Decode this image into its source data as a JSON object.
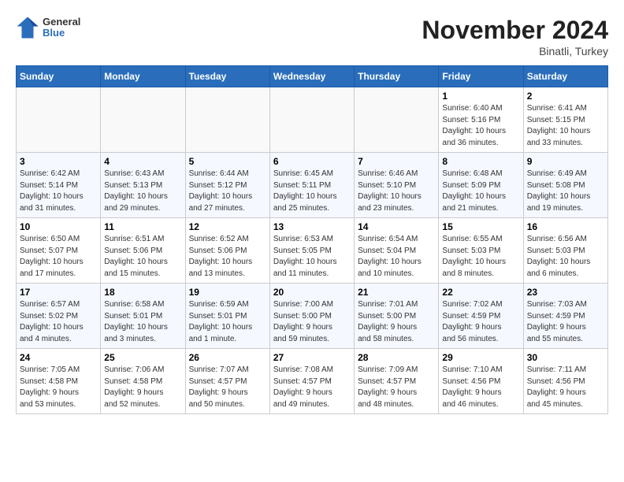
{
  "header": {
    "logo_general": "General",
    "logo_blue": "Blue",
    "month_title": "November 2024",
    "location": "Binatli, Turkey"
  },
  "weekdays": [
    "Sunday",
    "Monday",
    "Tuesday",
    "Wednesday",
    "Thursday",
    "Friday",
    "Saturday"
  ],
  "weeks": [
    [
      {
        "day": "",
        "info": ""
      },
      {
        "day": "",
        "info": ""
      },
      {
        "day": "",
        "info": ""
      },
      {
        "day": "",
        "info": ""
      },
      {
        "day": "",
        "info": ""
      },
      {
        "day": "1",
        "info": "Sunrise: 6:40 AM\nSunset: 5:16 PM\nDaylight: 10 hours\nand 36 minutes."
      },
      {
        "day": "2",
        "info": "Sunrise: 6:41 AM\nSunset: 5:15 PM\nDaylight: 10 hours\nand 33 minutes."
      }
    ],
    [
      {
        "day": "3",
        "info": "Sunrise: 6:42 AM\nSunset: 5:14 PM\nDaylight: 10 hours\nand 31 minutes."
      },
      {
        "day": "4",
        "info": "Sunrise: 6:43 AM\nSunset: 5:13 PM\nDaylight: 10 hours\nand 29 minutes."
      },
      {
        "day": "5",
        "info": "Sunrise: 6:44 AM\nSunset: 5:12 PM\nDaylight: 10 hours\nand 27 minutes."
      },
      {
        "day": "6",
        "info": "Sunrise: 6:45 AM\nSunset: 5:11 PM\nDaylight: 10 hours\nand 25 minutes."
      },
      {
        "day": "7",
        "info": "Sunrise: 6:46 AM\nSunset: 5:10 PM\nDaylight: 10 hours\nand 23 minutes."
      },
      {
        "day": "8",
        "info": "Sunrise: 6:48 AM\nSunset: 5:09 PM\nDaylight: 10 hours\nand 21 minutes."
      },
      {
        "day": "9",
        "info": "Sunrise: 6:49 AM\nSunset: 5:08 PM\nDaylight: 10 hours\nand 19 minutes."
      }
    ],
    [
      {
        "day": "10",
        "info": "Sunrise: 6:50 AM\nSunset: 5:07 PM\nDaylight: 10 hours\nand 17 minutes."
      },
      {
        "day": "11",
        "info": "Sunrise: 6:51 AM\nSunset: 5:06 PM\nDaylight: 10 hours\nand 15 minutes."
      },
      {
        "day": "12",
        "info": "Sunrise: 6:52 AM\nSunset: 5:06 PM\nDaylight: 10 hours\nand 13 minutes."
      },
      {
        "day": "13",
        "info": "Sunrise: 6:53 AM\nSunset: 5:05 PM\nDaylight: 10 hours\nand 11 minutes."
      },
      {
        "day": "14",
        "info": "Sunrise: 6:54 AM\nSunset: 5:04 PM\nDaylight: 10 hours\nand 10 minutes."
      },
      {
        "day": "15",
        "info": "Sunrise: 6:55 AM\nSunset: 5:03 PM\nDaylight: 10 hours\nand 8 minutes."
      },
      {
        "day": "16",
        "info": "Sunrise: 6:56 AM\nSunset: 5:03 PM\nDaylight: 10 hours\nand 6 minutes."
      }
    ],
    [
      {
        "day": "17",
        "info": "Sunrise: 6:57 AM\nSunset: 5:02 PM\nDaylight: 10 hours\nand 4 minutes."
      },
      {
        "day": "18",
        "info": "Sunrise: 6:58 AM\nSunset: 5:01 PM\nDaylight: 10 hours\nand 3 minutes."
      },
      {
        "day": "19",
        "info": "Sunrise: 6:59 AM\nSunset: 5:01 PM\nDaylight: 10 hours\nand 1 minute."
      },
      {
        "day": "20",
        "info": "Sunrise: 7:00 AM\nSunset: 5:00 PM\nDaylight: 9 hours\nand 59 minutes."
      },
      {
        "day": "21",
        "info": "Sunrise: 7:01 AM\nSunset: 5:00 PM\nDaylight: 9 hours\nand 58 minutes."
      },
      {
        "day": "22",
        "info": "Sunrise: 7:02 AM\nSunset: 4:59 PM\nDaylight: 9 hours\nand 56 minutes."
      },
      {
        "day": "23",
        "info": "Sunrise: 7:03 AM\nSunset: 4:59 PM\nDaylight: 9 hours\nand 55 minutes."
      }
    ],
    [
      {
        "day": "24",
        "info": "Sunrise: 7:05 AM\nSunset: 4:58 PM\nDaylight: 9 hours\nand 53 minutes."
      },
      {
        "day": "25",
        "info": "Sunrise: 7:06 AM\nSunset: 4:58 PM\nDaylight: 9 hours\nand 52 minutes."
      },
      {
        "day": "26",
        "info": "Sunrise: 7:07 AM\nSunset: 4:57 PM\nDaylight: 9 hours\nand 50 minutes."
      },
      {
        "day": "27",
        "info": "Sunrise: 7:08 AM\nSunset: 4:57 PM\nDaylight: 9 hours\nand 49 minutes."
      },
      {
        "day": "28",
        "info": "Sunrise: 7:09 AM\nSunset: 4:57 PM\nDaylight: 9 hours\nand 48 minutes."
      },
      {
        "day": "29",
        "info": "Sunrise: 7:10 AM\nSunset: 4:56 PM\nDaylight: 9 hours\nand 46 minutes."
      },
      {
        "day": "30",
        "info": "Sunrise: 7:11 AM\nSunset: 4:56 PM\nDaylight: 9 hours\nand 45 minutes."
      }
    ]
  ]
}
